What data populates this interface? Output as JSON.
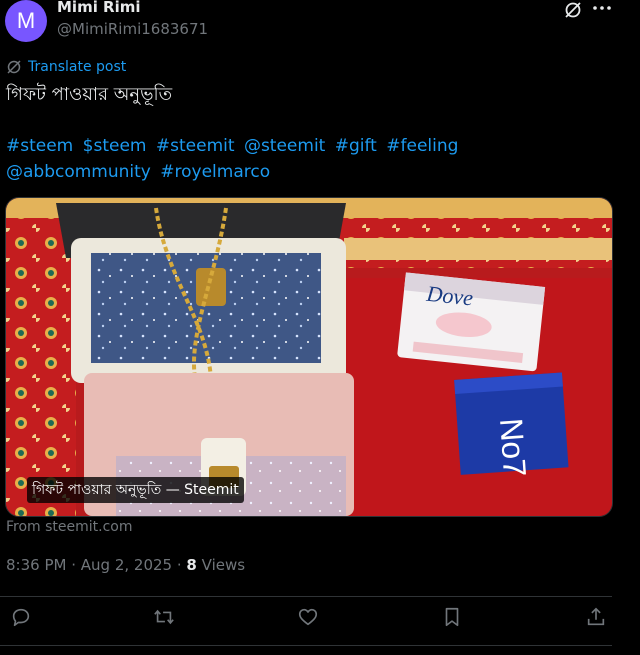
{
  "author": {
    "avatar_letter": "M",
    "display_name": "Mimi Rimi",
    "handle": "@MimiRimi1683671"
  },
  "icons": {
    "grok": "grok-slash-icon",
    "more": "more-icon"
  },
  "translate_label": "Translate post",
  "post_text": "গিফট পাওয়ার অনুভূতি",
  "hashtags": [
    "#steem",
    "$steem",
    "#steemit",
    "@steemit",
    "#gift",
    "#feeling",
    "@abbcommunity",
    "#royelmarco"
  ],
  "media_card": {
    "caption": "গিফট পাওয়ার অনুভূতি — Steemit",
    "source": "From steemit.com"
  },
  "meta": {
    "time": "8:36 PM",
    "date": "Aug 2, 2025",
    "views_count": "8",
    "views_label": "Views"
  },
  "actions": [
    "reply-icon",
    "repost-icon",
    "like-icon",
    "bookmark-icon",
    "share-icon"
  ],
  "colors": {
    "background": "#000000",
    "text": "#e7e9ea",
    "muted": "#71767b",
    "link": "#1d9bf0",
    "avatar": "#7856ff"
  }
}
